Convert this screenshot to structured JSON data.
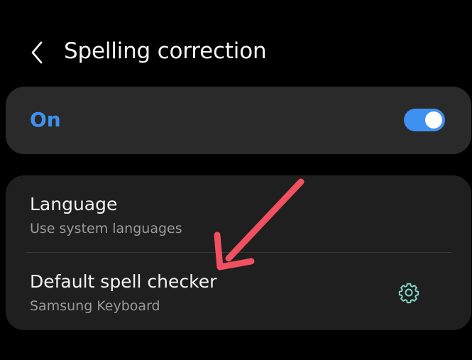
{
  "header": {
    "back_icon": "chevron-left-icon",
    "title": "Spelling correction"
  },
  "master_switch": {
    "label": "On",
    "state": true,
    "accent_color": "#3e91f0"
  },
  "settings": {
    "language": {
      "title": "Language",
      "subtitle": "Use system languages"
    },
    "spell_checker": {
      "title": "Default spell checker",
      "subtitle": "Samsung Keyboard",
      "settings_icon": "gear-icon",
      "icon_color": "#7fd3c7"
    }
  },
  "annotation": {
    "type": "arrow",
    "color": "#f0505f",
    "points_to": "Default spell checker"
  }
}
